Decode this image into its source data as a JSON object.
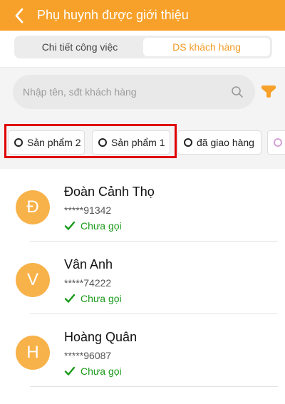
{
  "header": {
    "title": "Phụ huynh được giới thiệu",
    "back_icon": "chevron-left-icon"
  },
  "tabs": [
    {
      "label": "Chi tiết công việc",
      "active": false
    },
    {
      "label": "DS khách hàng",
      "active": true
    }
  ],
  "search": {
    "placeholder": "Nhập tên, sđt khách hàng",
    "value": ""
  },
  "filters": [
    {
      "label": "Sản phẩm 2"
    },
    {
      "label": "Sản phẩm 1"
    },
    {
      "label": "đã giao hàng"
    }
  ],
  "customers": [
    {
      "initial": "Đ",
      "name": "Đoàn Cảnh Thọ",
      "phone": "*****91342",
      "status": "Chưa gọi"
    },
    {
      "initial": "V",
      "name": "Vân Anh",
      "phone": "*****74222",
      "status": "Chưa gọi"
    },
    {
      "initial": "H",
      "name": "Hoàng Quân",
      "phone": "*****96087",
      "status": "Chưa gọi"
    }
  ],
  "colors": {
    "primary": "#f7a12a",
    "tab_active_text": "#f39b25",
    "status_green": "#1a9a1a",
    "highlight_red": "#e00000",
    "avatar": "#f8b24a"
  }
}
